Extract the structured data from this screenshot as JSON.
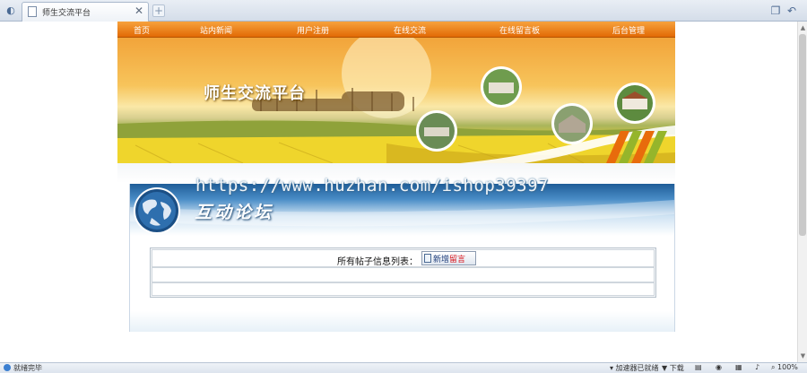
{
  "browser": {
    "tab_title": "师生交流平台",
    "tab_close": "✕",
    "new_tab": "+",
    "status_text": "就绪完毕",
    "status_items": {
      "accelerator": "▾ 加速器已就绪",
      "download": "▼ 下载",
      "zoom": "100%"
    }
  },
  "nav": {
    "items": [
      "首页",
      "站内新闻",
      "用户注册",
      "在线交流",
      "在线留言板",
      "后台管理"
    ]
  },
  "banner": {
    "title": "师生交流平台"
  },
  "forum": {
    "heading": "互动论坛",
    "list_title": "所有帖子信息列表：",
    "new_message_prefix": "新增",
    "new_message_accent": "留言"
  },
  "watermark": "https://www.huzhan.com/ishop39397",
  "colors": {
    "nav_orange": "#e26a05",
    "forum_blue": "#1f5d98",
    "accent_red": "#d8131a"
  }
}
